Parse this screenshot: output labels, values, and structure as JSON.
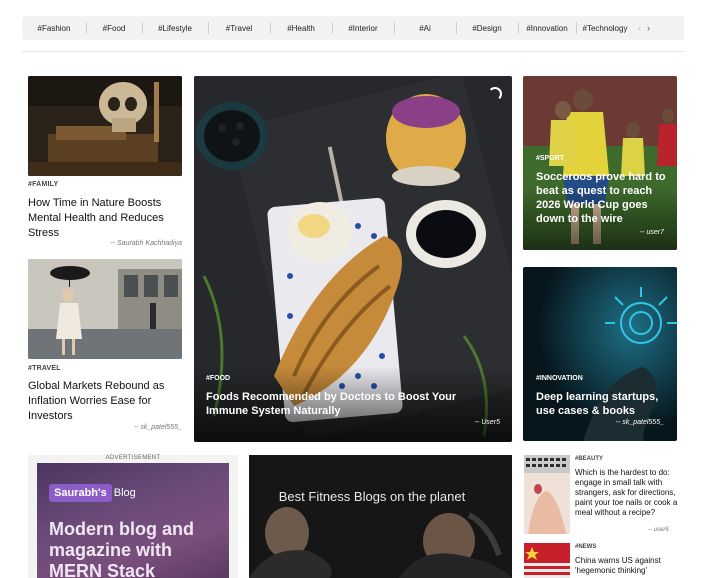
{
  "tags": [
    "#Fashion",
    "#Food",
    "#Lifestyle",
    "#Travel",
    "#Health",
    "#Interior",
    "#Ai",
    "#Design",
    "#Innovation",
    "#Technology"
  ],
  "tag_nav": {
    "prev": "‹",
    "next": "›"
  },
  "left_cards": [
    {
      "category": "#FAMILY",
      "title": "How Time in Nature Boosts Mental Health and Reduces Stress",
      "author": "-- Saurabh Kachhadiya"
    },
    {
      "category": "#TRAVEL",
      "title": "Global Markets Rebound as Inflation Worries Ease for Investors",
      "author": "-- sk_patel555_"
    }
  ],
  "featured": {
    "category": "#FOOD",
    "title": "Foods Recommended by Doctors to Boost Your Immune System Naturally",
    "author": "-- User5"
  },
  "right_cards": [
    {
      "category": "#SPORT",
      "title": "Socceroos prove hard to beat as quest to reach 2026 World Cup goes down to the wire",
      "author": "-- user7"
    },
    {
      "category": "#INNOVATION",
      "title": "Deep learning startups, use cases & books",
      "author": "-- sk_patel555_"
    }
  ],
  "ad": {
    "label": "ADVERTISEMENT",
    "logo_highlight": "Saurabh's",
    "logo_rest": "Blog",
    "headline": "Modern blog and magazine with MERN Stack"
  },
  "fitness": {
    "title": "Best Fitness Blogs on the planet"
  },
  "mini_cards": [
    {
      "category": "#BEAUTY",
      "title": "Which is the hardest to do: engage in small talk with strangers, ask for directions, paint your toe nails or cook a meal without a recipe?",
      "author": "-- user6"
    },
    {
      "category": "#NEWS",
      "title": "China warns US against 'hegemonic thinking'"
    }
  ]
}
